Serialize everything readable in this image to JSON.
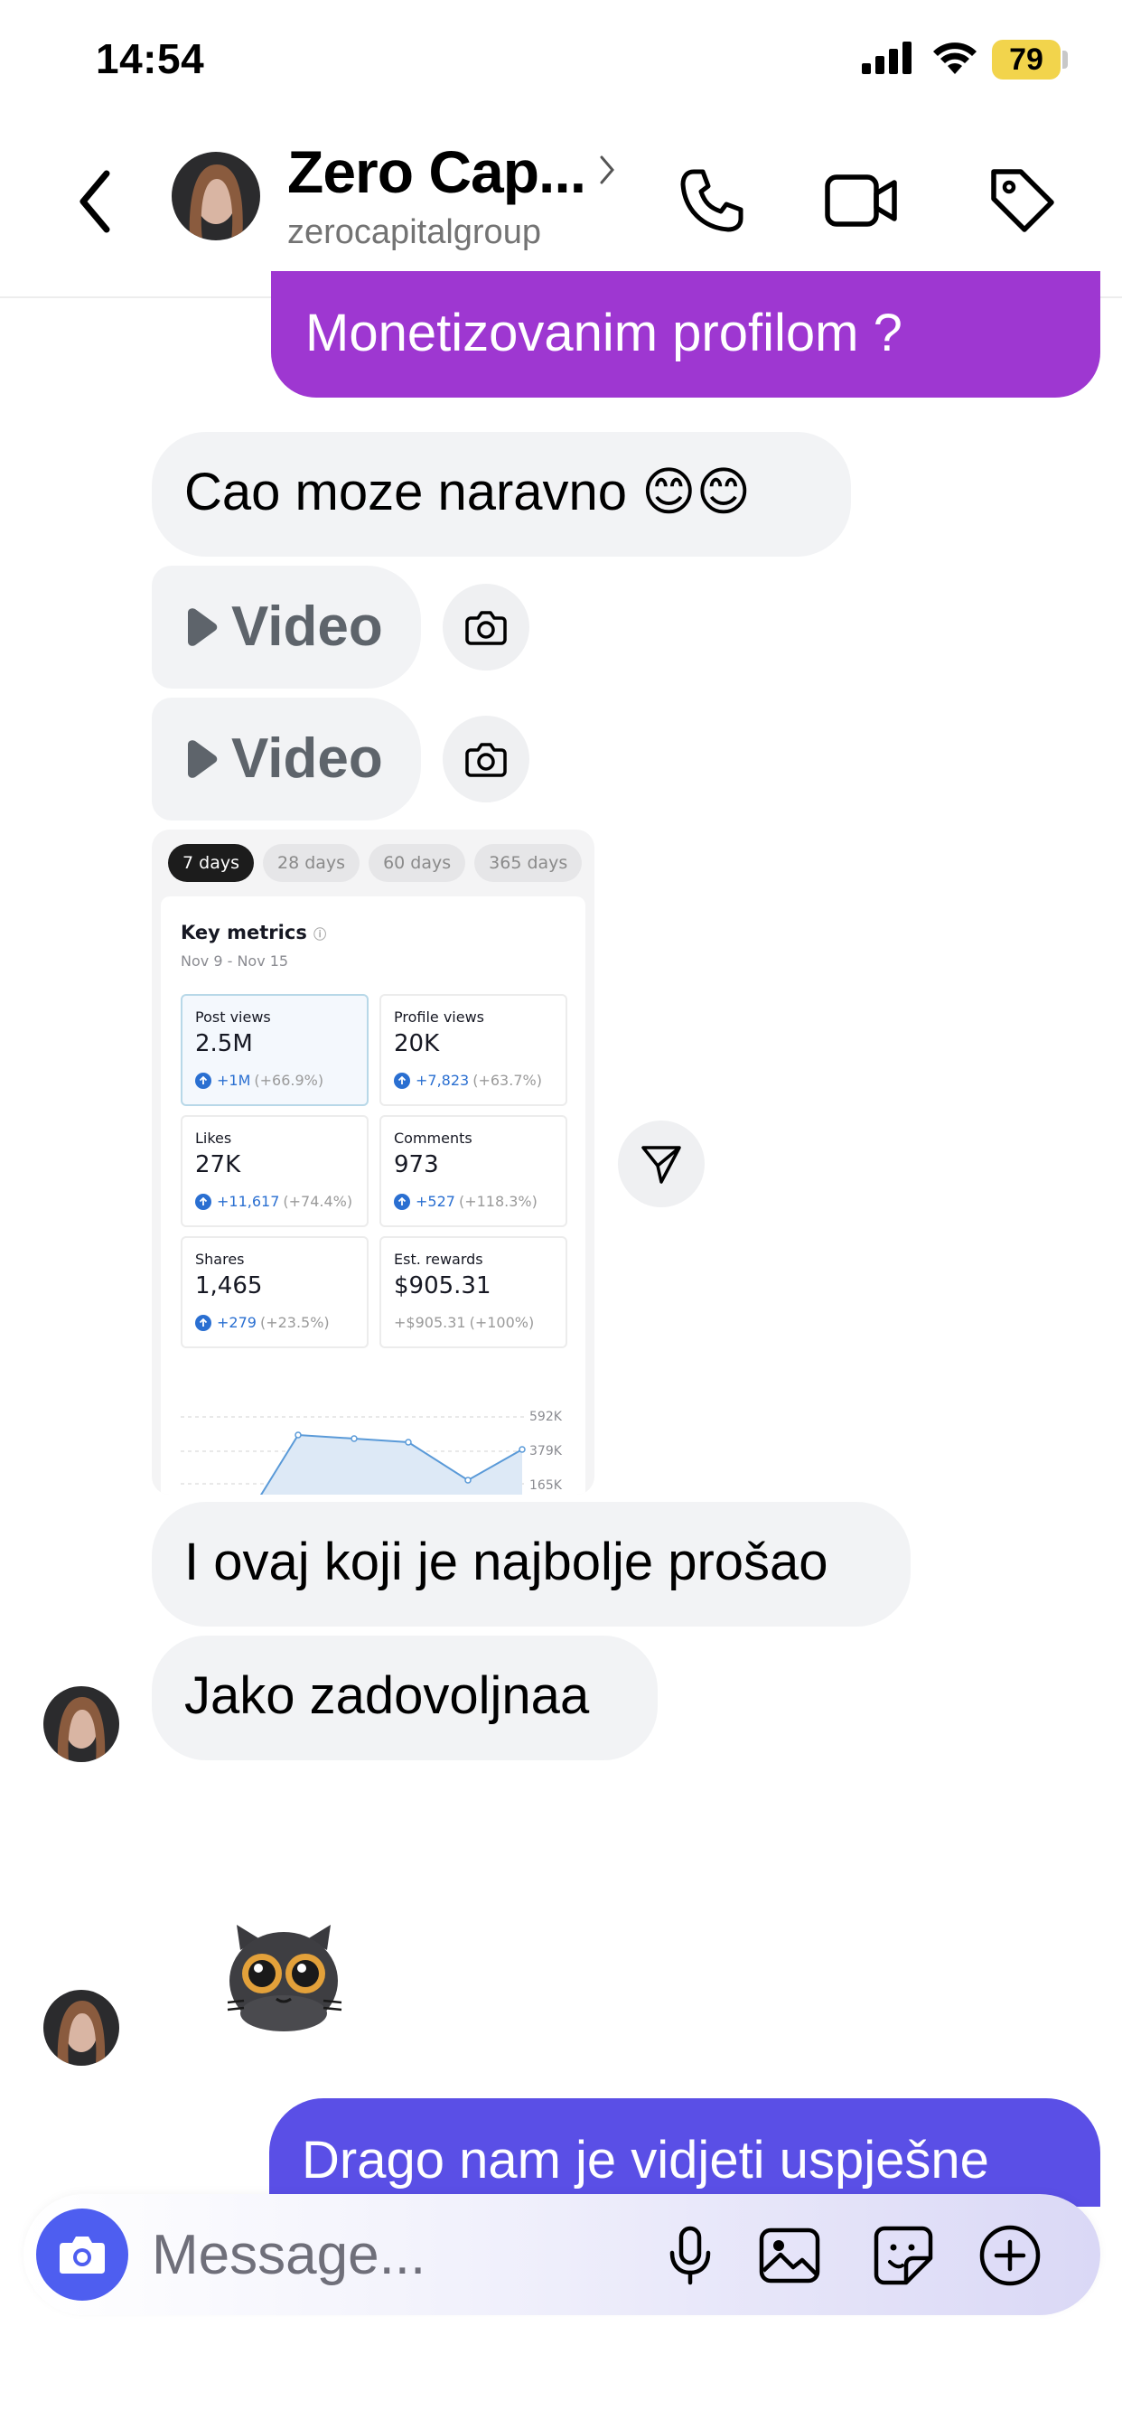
{
  "status_bar": {
    "time": "14:54",
    "battery": "79"
  },
  "header": {
    "name": "Zero Cap...",
    "handle": "zerocapitalgroup"
  },
  "messages": {
    "outgoing_top": "Monetizovanim profilom ?",
    "incoming_1": "Cao moze naravno 😊😊",
    "video_1_label": "Video",
    "video_2_label": "Video",
    "incoming_2": "I ovaj koji je najbolje prošao",
    "incoming_3": "Jako zadovoljnaa",
    "outgoing_bottom": "Drago nam je vidjeti uspješne"
  },
  "screenshot": {
    "tabs": [
      "7 days",
      "28 days",
      "60 days",
      "365 days"
    ],
    "title": "Key metrics",
    "date_range": "Nov 9 - Nov 15",
    "metrics": [
      {
        "label": "Post views",
        "value": "2.5M",
        "delta": "+1M",
        "pct": "(+66.9%)"
      },
      {
        "label": "Profile views",
        "value": "20K",
        "delta": "+7,823",
        "pct": "(+63.7%)"
      },
      {
        "label": "Likes",
        "value": "27K",
        "delta": "+11,617",
        "pct": "(+74.4%)"
      },
      {
        "label": "Comments",
        "value": "973",
        "delta": "+527",
        "pct": "(+118.3%)"
      },
      {
        "label": "Shares",
        "value": "1,465",
        "delta": "+279",
        "pct": "(+23.5%)"
      },
      {
        "label": "Est. rewards",
        "value": "$905.31",
        "delta": "+$905.31",
        "pct": "(+100%)"
      }
    ],
    "chart_ticks": [
      "592K",
      "379K",
      "165K"
    ]
  },
  "composer": {
    "placeholder": "Message..."
  },
  "colors": {
    "outgoing_purple": "#9e37d1",
    "outgoing_blue": "#5a4fe6",
    "camera_button": "#4e5ef0",
    "link_blue": "#2a6fd1"
  }
}
